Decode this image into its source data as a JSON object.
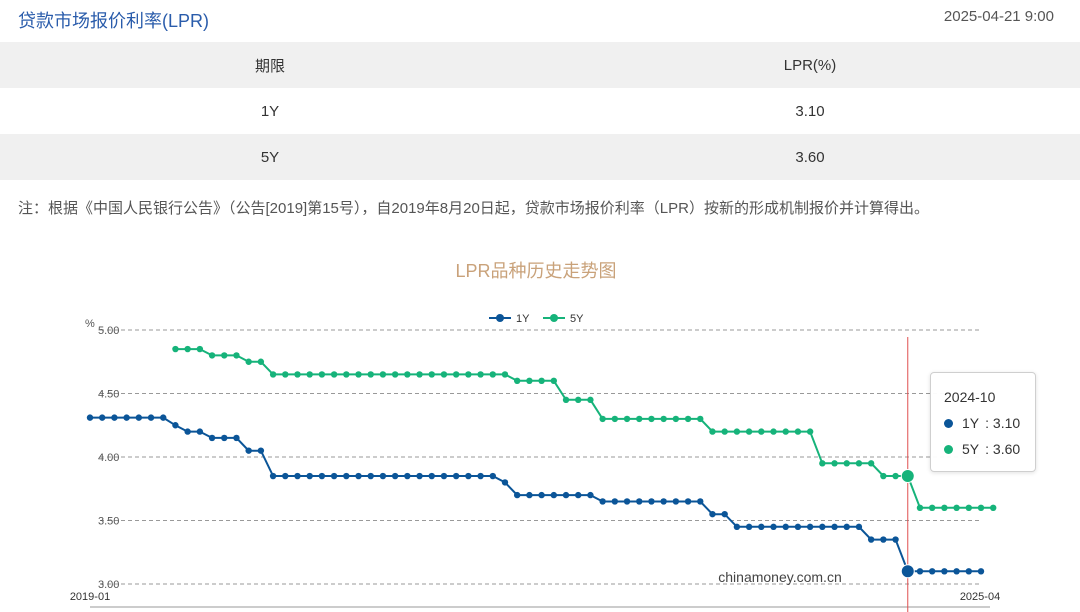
{
  "header": {
    "title": "贷款市场报价利率(LPR)",
    "datetime": "2025-04-21 9:00"
  },
  "table": {
    "headers": [
      "期限",
      "LPR(%)"
    ],
    "rows": [
      {
        "term": "1Y",
        "rate": "3.10"
      },
      {
        "term": "5Y",
        "rate": "3.60"
      }
    ]
  },
  "note": "注：根据《中国人民银行公告》（公告[2019]第15号），自2019年8月20日起，贷款市场报价利率（LPR）按新的形成机制报价并计算得出。",
  "watermark": "chinamoney.com.cn",
  "tooltip": {
    "title": "2024-10",
    "rows": [
      {
        "label": "1Y",
        "value": ": 3.10"
      },
      {
        "label": "5Y",
        "value": ": 3.60"
      }
    ]
  },
  "colors": {
    "title": "#2a5cab",
    "series_1y": "#0b5598",
    "series_5y": "#16b37a",
    "chart_title": "#c9a27a",
    "marker_line": "#e05050"
  },
  "chart_data": {
    "type": "line",
    "title": "LPR品种历史走势图",
    "ylabel": "%",
    "ylim": [
      3.0,
      5.0
    ],
    "yticks": [
      "3.00",
      "3.50",
      "4.00",
      "4.50",
      "5.00"
    ],
    "x_tick_labels": [
      "2019-01",
      "2025-04"
    ],
    "x_range": [
      "2019-01",
      "2025-04"
    ],
    "grid": true,
    "legend_position": "top-center",
    "highlight": "2024-10",
    "series": [
      {
        "name": "1Y",
        "values": [
          4.31,
          4.31,
          4.31,
          4.31,
          4.31,
          4.31,
          4.31,
          4.25,
          4.2,
          4.2,
          4.15,
          4.15,
          4.15,
          4.05,
          4.05,
          3.85,
          3.85,
          3.85,
          3.85,
          3.85,
          3.85,
          3.85,
          3.85,
          3.85,
          3.85,
          3.85,
          3.85,
          3.85,
          3.85,
          3.85,
          3.85,
          3.85,
          3.85,
          3.85,
          3.8,
          3.7,
          3.7,
          3.7,
          3.7,
          3.7,
          3.7,
          3.7,
          3.65,
          3.65,
          3.65,
          3.65,
          3.65,
          3.65,
          3.65,
          3.65,
          3.65,
          3.55,
          3.55,
          3.45,
          3.45,
          3.45,
          3.45,
          3.45,
          3.45,
          3.45,
          3.45,
          3.45,
          3.45,
          3.45,
          3.35,
          3.35,
          3.35,
          3.1,
          3.1,
          3.1,
          3.1,
          3.1,
          3.1,
          3.1
        ]
      },
      {
        "name": "5Y",
        "values": [
          null,
          null,
          null,
          null,
          null,
          null,
          null,
          4.85,
          4.85,
          4.85,
          4.8,
          4.8,
          4.8,
          4.75,
          4.75,
          4.65,
          4.65,
          4.65,
          4.65,
          4.65,
          4.65,
          4.65,
          4.65,
          4.65,
          4.65,
          4.65,
          4.65,
          4.65,
          4.65,
          4.65,
          4.65,
          4.65,
          4.65,
          4.65,
          4.65,
          4.6,
          4.6,
          4.6,
          4.6,
          4.45,
          4.45,
          4.45,
          4.3,
          4.3,
          4.3,
          4.3,
          4.3,
          4.3,
          4.3,
          4.3,
          4.3,
          4.2,
          4.2,
          4.2,
          4.2,
          4.2,
          4.2,
          4.2,
          4.2,
          4.2,
          3.95,
          3.95,
          3.95,
          3.95,
          3.95,
          3.85,
          3.85,
          3.85,
          3.6,
          3.6,
          3.6,
          3.6,
          3.6,
          3.6,
          3.6
        ]
      }
    ]
  }
}
